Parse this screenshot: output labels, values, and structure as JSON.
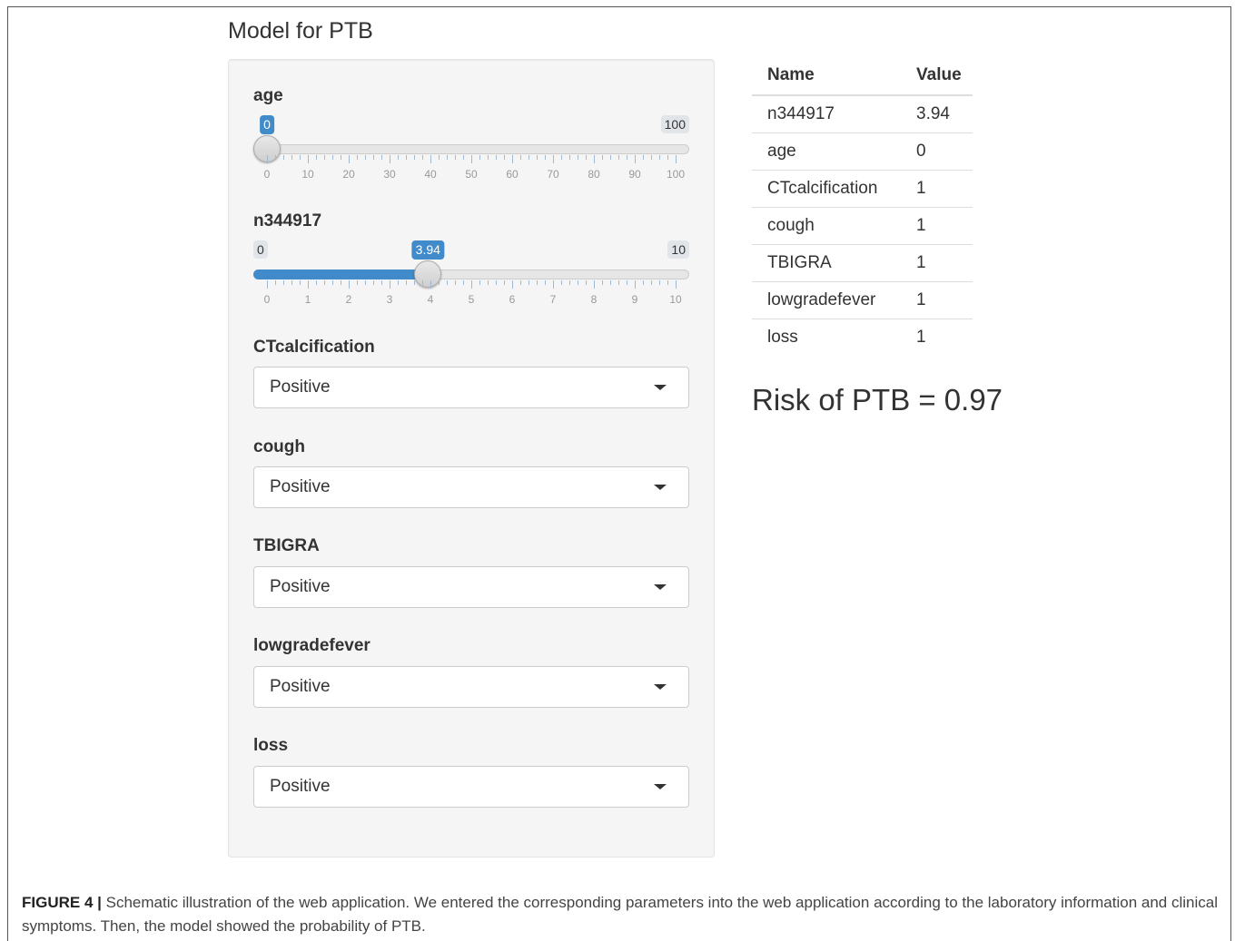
{
  "title": "Model for PTB",
  "inputs": {
    "age": {
      "label": "age",
      "min": 0,
      "max": 100,
      "value": 0,
      "min_label": "0",
      "max_label": "100",
      "value_label": "0",
      "ticks": [
        "0",
        "10",
        "20",
        "30",
        "40",
        "50",
        "60",
        "70",
        "80",
        "90",
        "100"
      ]
    },
    "n344917": {
      "label": "n344917",
      "min": 0,
      "max": 10,
      "value": 3.94,
      "min_label": "0",
      "max_label": "10",
      "value_label": "3.94",
      "ticks": [
        "0",
        "1",
        "2",
        "3",
        "4",
        "5",
        "6",
        "7",
        "8",
        "9",
        "10"
      ]
    },
    "selects": [
      {
        "label": "CTcalcification",
        "value": "Positive"
      },
      {
        "label": "cough",
        "value": "Positive"
      },
      {
        "label": "TBIGRA",
        "value": "Positive"
      },
      {
        "label": "lowgradefever",
        "value": "Positive"
      },
      {
        "label": "loss",
        "value": "Positive"
      }
    ]
  },
  "table": {
    "headers": [
      "Name",
      "Value"
    ],
    "rows": [
      [
        "n344917",
        "3.94"
      ],
      [
        "age",
        "0"
      ],
      [
        "CTcalcification",
        "1"
      ],
      [
        "cough",
        "1"
      ],
      [
        "TBIGRA",
        "1"
      ],
      [
        "lowgradefever",
        "1"
      ],
      [
        "loss",
        "1"
      ]
    ]
  },
  "result": "Risk of PTB = 0.97",
  "caption": {
    "label": "FIGURE 4 |",
    "text": " Schematic illustration of the web application. We entered the corresponding parameters into the web application according to the laboratory information and clinical symptoms. Then, the model showed the probability of PTB."
  },
  "colors": {
    "accent": "#428bca",
    "panel": "#f5f5f5"
  }
}
